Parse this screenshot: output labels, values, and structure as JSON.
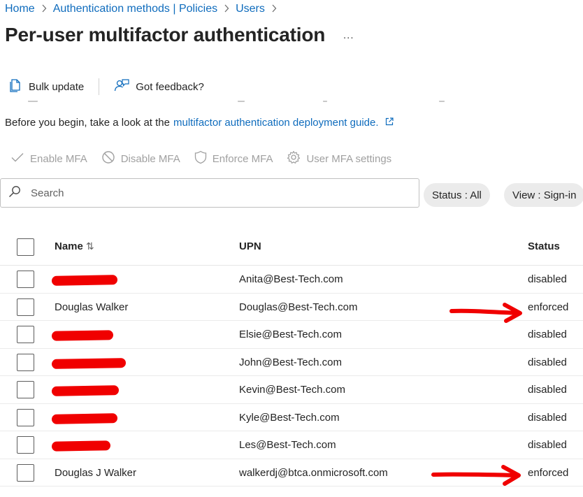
{
  "breadcrumb": {
    "items": [
      "Home",
      "Authentication methods | Policies",
      "Users"
    ],
    "separator": ">"
  },
  "page": {
    "title": "Per-user multifactor authentication",
    "more": "..."
  },
  "toolbar": {
    "bulk_update": "Bulk update",
    "feedback": "Got feedback?"
  },
  "info": {
    "text": "Before you begin, take a look at the",
    "link": "multifactor authentication deployment guide."
  },
  "actions": {
    "enable": "Enable MFA",
    "disable": "Disable MFA",
    "enforce": "Enforce MFA",
    "settings": "User MFA settings"
  },
  "search": {
    "placeholder": "Search",
    "value": ""
  },
  "filters": {
    "status": "Status : All",
    "view": "View : Sign-in"
  },
  "table": {
    "headers": {
      "name": "Name",
      "upn": "UPN",
      "status": "Status"
    },
    "rows": [
      {
        "name": "",
        "upn": "Anita@Best-Tech.com",
        "status": "disabled"
      },
      {
        "name": "Douglas Walker",
        "upn": "Douglas@Best-Tech.com",
        "status": "enforced"
      },
      {
        "name": "",
        "upn": "Elsie@Best-Tech.com",
        "status": "disabled"
      },
      {
        "name": "",
        "upn": "John@Best-Tech.com",
        "status": "disabled"
      },
      {
        "name": "",
        "upn": "Kevin@Best-Tech.com",
        "status": "disabled"
      },
      {
        "name": "",
        "upn": "Kyle@Best-Tech.com",
        "status": "disabled"
      },
      {
        "name": "",
        "upn": "Les@Best-Tech.com",
        "status": "disabled"
      },
      {
        "name": "Douglas J Walker",
        "upn": "walkerdj@btca.onmicrosoft.com",
        "status": "enforced"
      }
    ]
  },
  "colors": {
    "link": "#0f6cbd",
    "text": "#242424",
    "disabled_text": "#a0a0a0",
    "annotation_red": "#f00000",
    "pill_bg": "#ebebeb"
  },
  "icons": [
    "chevron-right-icon",
    "bulk-update-icon",
    "feedback-icon",
    "external-link-icon",
    "checkmark-icon",
    "block-icon",
    "shield-icon",
    "gear-icon",
    "search-icon",
    "sort-icon"
  ]
}
